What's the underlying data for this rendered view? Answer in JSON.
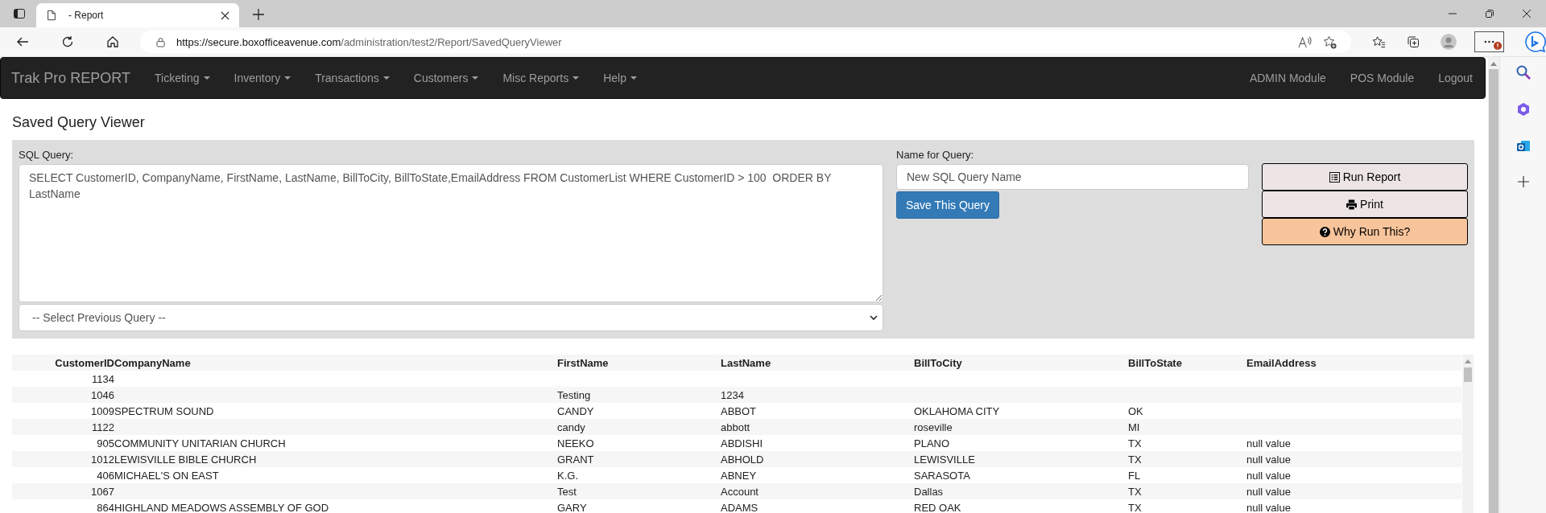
{
  "browser": {
    "tab_title": "- Report",
    "url_host": "https://secure.boxofficeavenue.com",
    "url_path": "/administration/test2/Report/SavedQueryViewer"
  },
  "navbar": {
    "brand": "Trak Pro REPORT",
    "menus": [
      {
        "label": "Ticketing"
      },
      {
        "label": "Inventory"
      },
      {
        "label": "Transactions"
      },
      {
        "label": "Customers"
      },
      {
        "label": "Misc Reports"
      },
      {
        "label": "Help"
      }
    ],
    "links": [
      "ADMIN Module",
      "POS Module",
      "Logout"
    ]
  },
  "page_title": "Saved Query Viewer",
  "query_form": {
    "sql_label": "SQL Query:",
    "sql_query": "SELECT CustomerID, CompanyName, FirstName, LastName, BillToCity, BillToState,EmailAddress FROM CustomerList WHERE CustomerID > 100  ORDER BY LastName",
    "previous_query": "-- Select Previous Query --",
    "name_label": "Name for Query:",
    "name_placeholder": "New SQL Query Name",
    "save_button": "Save This Query",
    "buttons": [
      {
        "kind": "report",
        "label": "Run Report"
      },
      {
        "kind": "print",
        "label": "Print"
      },
      {
        "kind": "help",
        "label": "Why Run This?"
      }
    ]
  },
  "table": {
    "columns": [
      "CustomerID",
      "CompanyName",
      "FirstName",
      "LastName",
      "BillToCity",
      "BillToState",
      "EmailAddress"
    ],
    "rows": [
      [
        "1134",
        "",
        "",
        "",
        "",
        "",
        ""
      ],
      [
        "1046",
        "",
        "Testing",
        "1234",
        "",
        "",
        ""
      ],
      [
        "1009",
        "SPECTRUM SOUND",
        "CANDY",
        "ABBOT",
        "OKLAHOMA CITY",
        "OK",
        ""
      ],
      [
        "1122",
        "",
        "candy",
        "abbott",
        "roseville",
        "MI",
        ""
      ],
      [
        "905",
        "COMMUNITY UNITARIAN CHURCH",
        "NEEKO",
        "ABDISHI",
        "PLANO",
        "TX",
        "null value"
      ],
      [
        "1012",
        "LEWISVILLE BIBLE CHURCH",
        "GRANT",
        "ABHOLD",
        "LEWISVILLE",
        "TX",
        "null value"
      ],
      [
        "406",
        "MICHAEL'S ON EAST",
        "K.G.",
        "ABNEY",
        "SARASOTA",
        "FL",
        "null value"
      ],
      [
        "1067",
        "",
        "Test",
        "Account",
        "Dallas",
        "TX",
        "null value"
      ],
      [
        "864",
        "HIGHLAND MEADOWS ASSEMBLY OF GOD",
        "GARY",
        "ADAMS",
        "RED OAK",
        "TX",
        "null value"
      ]
    ]
  }
}
